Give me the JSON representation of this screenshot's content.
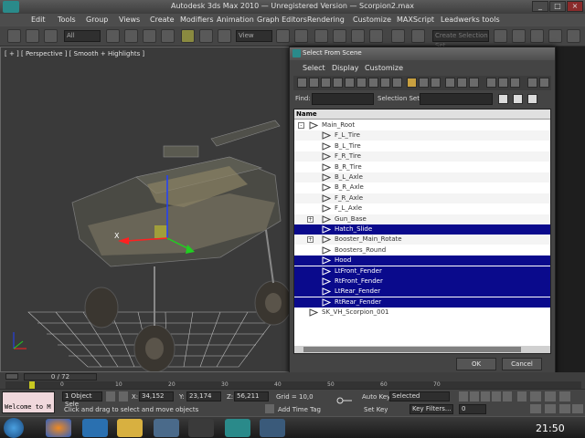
{
  "window": {
    "title": "Autodesk 3ds Max 2010 — Unregistered Version — Scorpion2.max",
    "title_app": "Autodesk 3ds Max 2010",
    "title_version": "Unregistered Version",
    "title_file": "Scorpion2.max"
  },
  "menubar": [
    "Edit",
    "Tools",
    "Group",
    "Views",
    "Create",
    "Modifiers",
    "Animation",
    "Graph Editors",
    "Rendering",
    "Customize",
    "MAXScript",
    "Leadwerks tools"
  ],
  "toolbar": {
    "filter_value": "All",
    "refcoord_value": "View",
    "selection_set_placeholder": "Create Selection Set"
  },
  "viewport": {
    "label": "[ + ] [ Perspective ] [ Smooth + Highlights ]",
    "gizmo_label": "X"
  },
  "dialog": {
    "title": "Select From Scene",
    "menu": [
      "Select",
      "Display",
      "Customize"
    ],
    "find_label": "Find:",
    "selection_set_label": "Selection Set:",
    "column_name": "Name",
    "rows": [
      {
        "label": "Main_Root",
        "level": 0,
        "expander": "-",
        "selected": false
      },
      {
        "label": "F_L_Tire",
        "level": 1,
        "expander": "",
        "selected": false
      },
      {
        "label": "B_L_Tire",
        "level": 1,
        "expander": "",
        "selected": false
      },
      {
        "label": "F_R_Tire",
        "level": 1,
        "expander": "",
        "selected": false
      },
      {
        "label": "B_R_Tire",
        "level": 1,
        "expander": "",
        "selected": false
      },
      {
        "label": "B_L_Axle",
        "level": 1,
        "expander": "",
        "selected": false
      },
      {
        "label": "B_R_Axle",
        "level": 1,
        "expander": "",
        "selected": false
      },
      {
        "label": "F_R_Axle",
        "level": 1,
        "expander": "",
        "selected": false
      },
      {
        "label": "F_L_Axle",
        "level": 1,
        "expander": "",
        "selected": false
      },
      {
        "label": "Gun_Base",
        "level": 1,
        "expander": "+",
        "selected": false
      },
      {
        "label": "Hatch_Slide",
        "level": 1,
        "expander": "",
        "selected": true
      },
      {
        "label": "Booster_Main_Rotate",
        "level": 1,
        "expander": "+",
        "selected": false
      },
      {
        "label": "Boosters_Round",
        "level": 1,
        "expander": "",
        "selected": false
      },
      {
        "label": "Hood",
        "level": 1,
        "expander": "",
        "selected": true
      },
      {
        "label": "LtFront_Fender",
        "level": 1,
        "expander": "",
        "selected": true
      },
      {
        "label": "RtFront_Fender",
        "level": 1,
        "expander": "",
        "selected": true
      },
      {
        "label": "LtRear_Fender",
        "level": 1,
        "expander": "",
        "selected": true
      },
      {
        "label": "RtRear_Fender",
        "level": 1,
        "expander": "",
        "selected": true
      },
      {
        "label": "SK_VH_Scorpion_001",
        "level": 0,
        "expander": "",
        "selected": false
      }
    ],
    "ok_label": "OK",
    "cancel_label": "Cancel"
  },
  "timeline": {
    "frame_display": "0 / 72",
    "ticks": [
      "0",
      "10",
      "20",
      "30",
      "40",
      "50",
      "60",
      "70"
    ]
  },
  "status": {
    "welcome": "Welcome to M",
    "selection": "1 Object Sele",
    "x_label": "X:",
    "x_value": "34,152",
    "y_label": "Y:",
    "y_value": "23,174",
    "z_label": "Z:",
    "z_value": "56,211",
    "grid": "Grid = 10,0",
    "hint": "Click and drag to select and move objects",
    "add_time_tag": "Add Time Tag",
    "auto_key": "Auto Key",
    "auto_key_value": "Selected",
    "set_key": "Set Key",
    "key_filters": "Key Filters...",
    "frame_value": "0"
  },
  "taskbar": {
    "time": "21:50"
  },
  "colors": {
    "selection": "#0a0a8c",
    "viewport_bg": "#3a3a3a",
    "ui_gray": "#444444"
  }
}
